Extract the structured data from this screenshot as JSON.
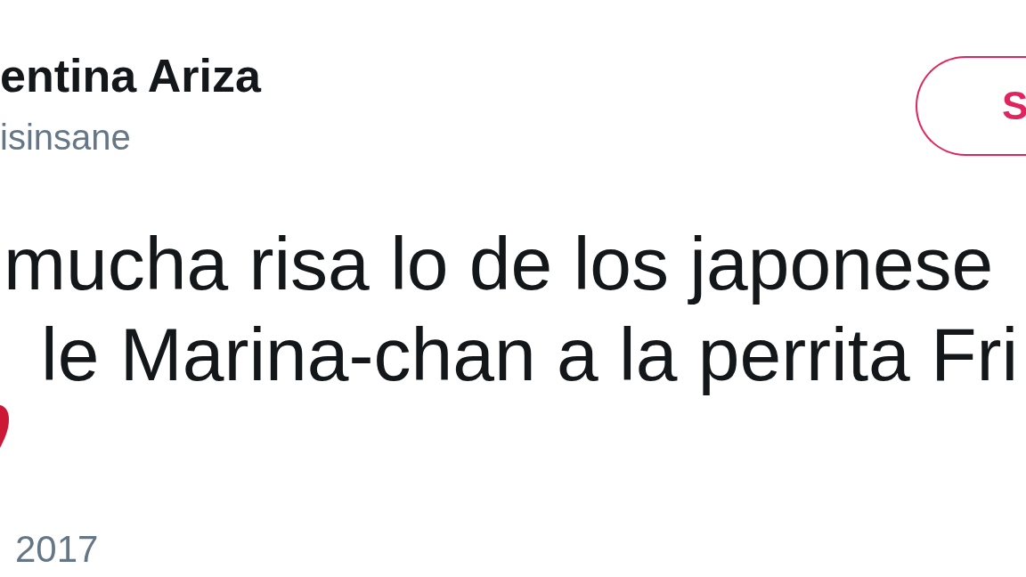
{
  "author": {
    "name": "entina Ariza",
    "handle": "isinsane"
  },
  "follow_button": {
    "label": "S"
  },
  "tweet": {
    "lines": [
      "mucha risa lo de los japonese",
      "le Marina-chan a la perrita Fri"
    ]
  },
  "date": "2017"
}
